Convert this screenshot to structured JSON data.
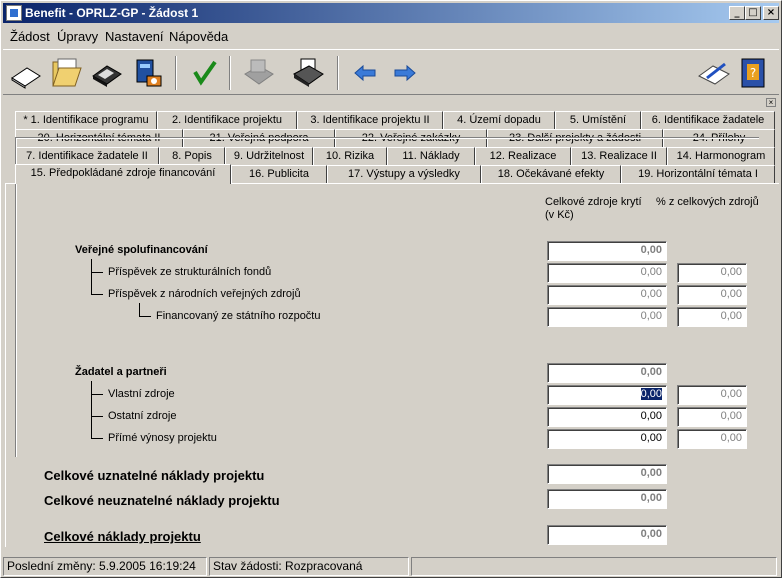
{
  "window": {
    "title": "Benefit - OPRLZ-GP - Žádost 1"
  },
  "titlebar_buttons": [
    "_",
    "□",
    "×"
  ],
  "menu": [
    {
      "label": "Žádost"
    },
    {
      "label": "Úpravy"
    },
    {
      "label": "Nastavení"
    },
    {
      "label": "Nápověda"
    }
  ],
  "toolbar": {
    "icons": [
      "new-document-icon",
      "open-folder-icon",
      "save-disk-icon",
      "network-save-icon",
      "check-icon",
      "print-disabled-icon",
      "print-icon",
      "back-arrow-icon",
      "forward-arrow-icon",
      "pen-paper-icon",
      "help-book-icon"
    ]
  },
  "tabs": {
    "row1": [
      "* 1. Identifikace programu",
      "2. Identifikace projektu",
      "3. Identifikace projektu II",
      "4. Území dopadu",
      "5. Umístění",
      "6. Identifikace žadatele"
    ],
    "row2": [
      "20. Horizontální témata II",
      "21. Veřejná podpora",
      "22. Veřejné zakázky",
      "23. Další projekty a žádosti",
      "24. Přílohy"
    ],
    "row3": [
      "7. Identifikace žadatele II",
      "8. Popis",
      "9. Udržitelnost",
      "10. Rizika",
      "11. Náklady",
      "12. Realizace",
      "13. Realizace II",
      "14. Harmonogram"
    ],
    "row4": [
      "15. Předpokládané zdroje financování",
      "16. Publicita",
      "17. Výstupy a výsledky",
      "18. Očekávané efekty",
      "19. Horizontální témata I"
    ]
  },
  "headers": {
    "col1_line1": "Celkové zdroje krytí",
    "col1_line2": "(v Kč)",
    "col2": "% z celkových zdrojů"
  },
  "form": {
    "verejne": {
      "label": "Veřejné spolufinancování",
      "value": "0,00"
    },
    "strukturalni": {
      "label": "Příspěvek ze strukturálních fondů",
      "value": "0,00",
      "pct": "0,00"
    },
    "narodni": {
      "label": "Příspěvek z národních veřejných zdrojů",
      "value": "0,00",
      "pct": "0,00"
    },
    "statni": {
      "label": "Financovaný ze státního rozpočtu",
      "value": "0,00",
      "pct": "0,00"
    },
    "zadatel": {
      "label": "Žadatel a partneři",
      "value": "0,00"
    },
    "vlastni": {
      "label": "Vlastní zdroje",
      "value": "0,00",
      "pct": "0,00"
    },
    "ostatni": {
      "label": "Ostatní zdroje",
      "value": "0,00",
      "pct": "0,00"
    },
    "prime": {
      "label": "Přímé výnosy projektu",
      "value": "0,00",
      "pct": "0,00"
    },
    "uznatelne": {
      "label": "Celkové uznatelné náklady projektu",
      "value": "0,00"
    },
    "neuznatelne": {
      "label": "Celkové neuznatelné náklady projektu",
      "value": "0,00"
    },
    "celkove": {
      "label": "Celkové náklady projektu",
      "value": "0,00"
    }
  },
  "statusbar": {
    "last_change": "Poslední změny: 5.9.2005 16:19:24",
    "state": "Stav žádosti: Rozpracovaná"
  }
}
